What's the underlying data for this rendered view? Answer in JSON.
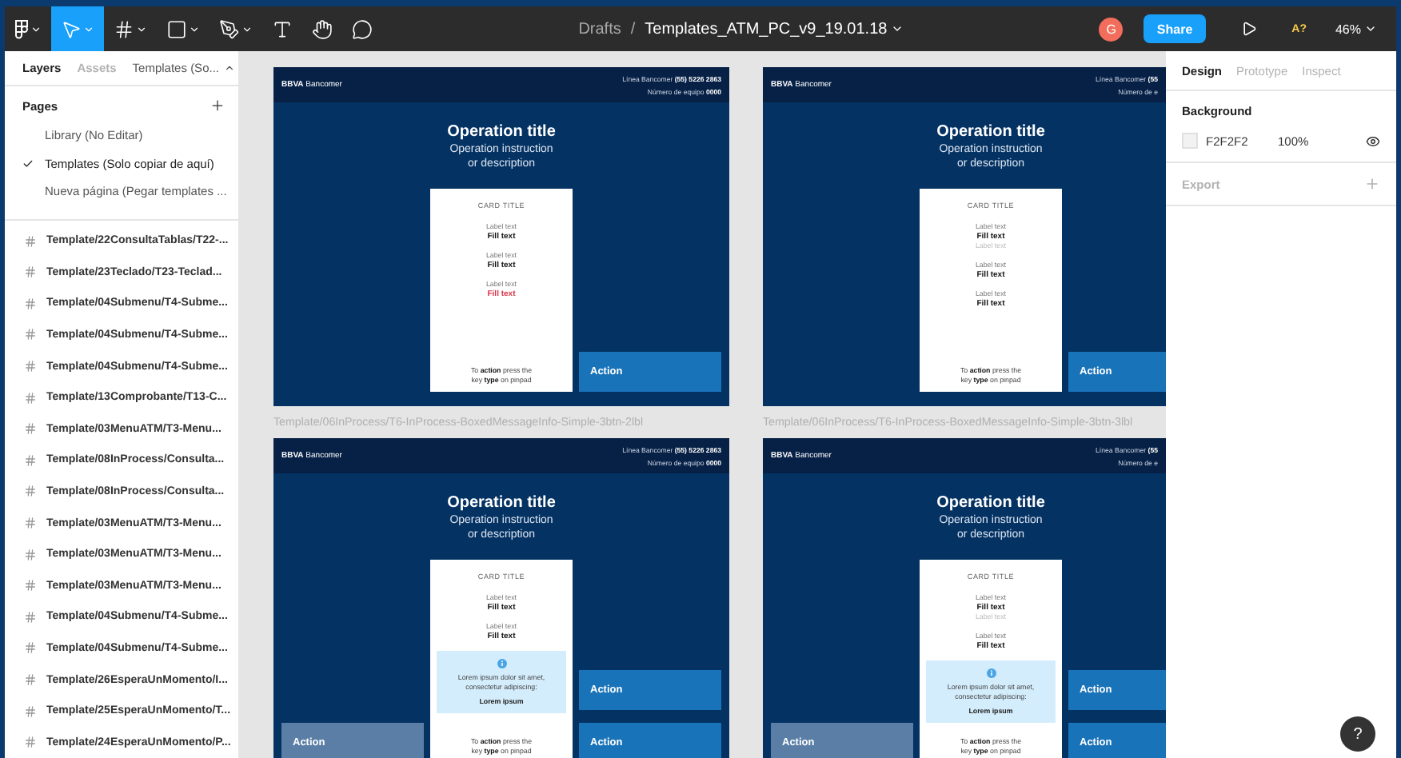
{
  "toolbar": {
    "tools": [
      {
        "kind": "main-menu",
        "selected": false,
        "has_menu": true
      },
      {
        "kind": "move",
        "selected": true,
        "has_menu": true
      },
      {
        "kind": "frame",
        "selected": false,
        "has_menu": true
      },
      {
        "kind": "shape",
        "selected": false,
        "has_menu": true
      },
      {
        "kind": "pen",
        "selected": false,
        "has_menu": true
      },
      {
        "kind": "text",
        "selected": false,
        "has_menu": false
      },
      {
        "kind": "hand",
        "selected": false,
        "has_menu": false
      },
      {
        "kind": "comment",
        "selected": false,
        "has_menu": false
      }
    ],
    "breadcrumb": "Drafts",
    "separator": "/",
    "file_name": "Templates_ATM_PC_v9_19.01.18",
    "avatar": "G",
    "share": "Share",
    "assist": "A?",
    "zoom": "46%"
  },
  "left_panel": {
    "tabs": [
      {
        "label": "Layers",
        "selected": true
      },
      {
        "label": "Assets",
        "selected": false
      }
    ],
    "page_menu": "Templates (So...",
    "pages": {
      "title": "Pages",
      "items": [
        {
          "label": "Library (No Editar)",
          "selected": false
        },
        {
          "label": "Templates (Solo copiar de aquí)",
          "selected": true
        },
        {
          "label": "Nueva página (Pegar templates ...",
          "selected": false
        }
      ]
    },
    "layers": [
      "Template/22ConsultaTablas/T22-...",
      "Template/23Teclado/T23-Teclad...",
      "Template/04Submenu/T4-Subme...",
      "Template/04Submenu/T4-Subme...",
      "Template/04Submenu/T4-Subme...",
      "Template/13Comprobante/T13-C...",
      "Template/03MenuATM/T3-Menu...",
      "Template/08InProcess/Consulta...",
      "Template/08InProcess/Consulta...",
      "Template/03MenuATM/T3-Menu...",
      "Template/03MenuATM/T3-Menu...",
      "Template/03MenuATM/T3-Menu...",
      "Template/04Submenu/T4-Subme...",
      "Template/04Submenu/T4-Subme...",
      "Template/26EsperaUnMomento/I...",
      "Template/25EsperaUnMomento/T...",
      "Template/24EsperaUnMomento/P..."
    ]
  },
  "canvas": {
    "frames": [
      {
        "header": {
          "brand": "**BBVA** Bancomer",
          "lines": [
            "Línea Bancomer **(55) 5226 2863**",
            "Número de equipo **0000**"
          ]
        },
        "title": "Operation title",
        "instruction": [
          "Operation instruction",
          "or description"
        ],
        "card": {
          "title": "CARD TITLE",
          "groups": [
            [
              {
                "kind": "label",
                "text": "Label text"
              },
              {
                "kind": "fill",
                "text": "Fill text"
              }
            ],
            [
              {
                "kind": "label",
                "text": "Label text"
              },
              {
                "kind": "fill",
                "text": "Fill text"
              }
            ],
            [
              {
                "kind": "label",
                "text": "Label text"
              },
              {
                "kind": "alert",
                "text": "Fill text"
              }
            ]
          ],
          "footer": [
            "To **action** press the",
            "key **type** on pinpad"
          ]
        },
        "actions": [
          {
            "label": "Action",
            "kind": "primary-right"
          }
        ]
      },
      {
        "header": {
          "brand": "**BBVA** Bancomer",
          "lines": [
            "Línea Bancomer **(55**",
            "Número de e"
          ]
        },
        "title": "Operation title",
        "instruction": [
          "Operation instruction",
          "or description"
        ],
        "card": {
          "title": "CARD TITLE",
          "groups": [
            [
              {
                "kind": "label",
                "text": "Label text"
              },
              {
                "kind": "fill",
                "text": "Fill text"
              },
              {
                "kind": "hint",
                "text": "Label text"
              }
            ],
            [
              {
                "kind": "label",
                "text": "Label text"
              },
              {
                "kind": "fill",
                "text": "Fill text"
              }
            ],
            [
              {
                "kind": "label",
                "text": "Label text"
              },
              {
                "kind": "fill",
                "text": "Fill text"
              }
            ]
          ],
          "footer": [
            "To **action** press the",
            "key **type** on pinpad"
          ]
        },
        "actions": [
          {
            "label": "Action",
            "kind": "primary-right"
          }
        ]
      },
      {
        "label": "Template/06InProcess/T6-InProcess-BoxedMessageInfo-Simple-3btn-2lbl",
        "header": {
          "brand": "**BBVA** Bancomer",
          "lines": [
            "Línea Bancomer **(55) 5226 2863**",
            "Número de equipo **0000**"
          ]
        },
        "title": "Operation title",
        "instruction": [
          "Operation instruction",
          "or description"
        ],
        "card": {
          "title": "CARD TITLE",
          "groups": [
            [
              {
                "kind": "label",
                "text": "Label text"
              },
              {
                "kind": "fill",
                "text": "Fill text"
              }
            ],
            [
              {
                "kind": "label",
                "text": "Label text"
              },
              {
                "kind": "fill",
                "text": "Fill text"
              }
            ]
          ],
          "info": {
            "message": "Lorem ipsum dolor sit amet, consectetur adipiscing:",
            "emphasis": "Lorem ipsum"
          },
          "footer": [
            "To **action** press the",
            "key **type** on pinpad"
          ]
        },
        "actions": [
          {
            "label": "Action",
            "kind": "secondary-left"
          },
          {
            "label": "Action",
            "kind": "primary-right"
          },
          {
            "label": "Action",
            "kind": "primary-right"
          }
        ]
      },
      {
        "label": "Template/06InProcess/T6-InProcess-BoxedMessageInfo-Simple-3btn-3lbl",
        "header": {
          "brand": "**BBVA** Bancomer",
          "lines": [
            "Línea Bancomer **(55**",
            "Número de e"
          ]
        },
        "title": "Operation title",
        "instruction": [
          "Operation instruction",
          "or description"
        ],
        "card": {
          "title": "CARD TITLE",
          "groups": [
            [
              {
                "kind": "label",
                "text": "Label text"
              },
              {
                "kind": "fill",
                "text": "Fill text"
              },
              {
                "kind": "hint",
                "text": "Label text"
              }
            ],
            [
              {
                "kind": "label",
                "text": "Label text"
              },
              {
                "kind": "fill",
                "text": "Fill text"
              }
            ]
          ],
          "info": {
            "message": "Lorem ipsum dolor sit amet, consectetur adipiscing:",
            "emphasis": "Lorem ipsum"
          },
          "footer": [
            "To **action** press the",
            "key **type** on pinpad"
          ]
        },
        "actions": [
          {
            "label": "Action",
            "kind": "secondary-left"
          },
          {
            "label": "Action",
            "kind": "primary-right"
          },
          {
            "label": "Action",
            "kind": "primary-right"
          }
        ]
      }
    ]
  },
  "right_panel": {
    "tabs": [
      {
        "label": "Design",
        "selected": true
      },
      {
        "label": "Prototype",
        "selected": false
      },
      {
        "label": "Inspect",
        "selected": false
      }
    ],
    "background": {
      "title": "Background",
      "hex": "F2F2F2",
      "opacity": "100%",
      "visible": true
    },
    "export": {
      "title": "Export"
    }
  },
  "help": "?"
}
